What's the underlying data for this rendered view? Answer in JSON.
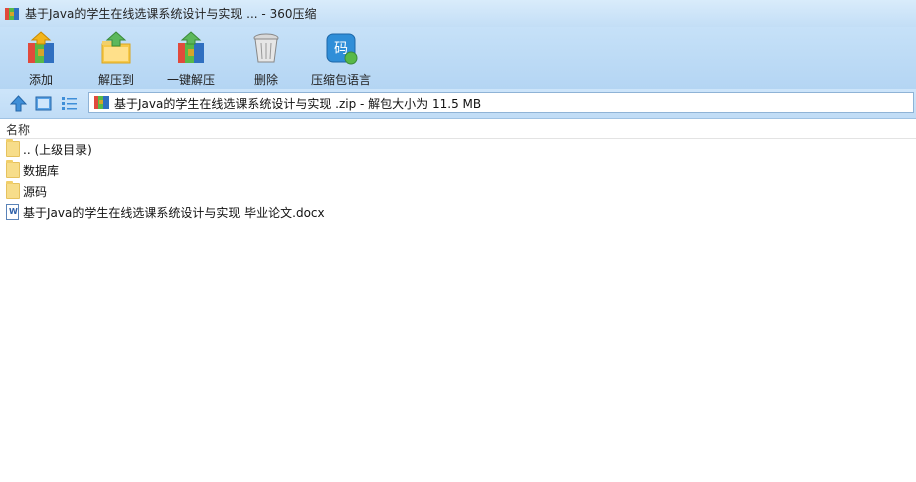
{
  "window": {
    "title": "基于Java的学生在线选课系统设计与实现 ... - 360压缩",
    "icon": "archive-icon"
  },
  "toolbar": {
    "buttons": [
      {
        "label": "添加",
        "icon": "add-archive-icon"
      },
      {
        "label": "解压到",
        "icon": "extract-to-folder-icon"
      },
      {
        "label": "一键解压",
        "icon": "one-click-extract-icon"
      },
      {
        "label": "删除",
        "icon": "trash-bin-icon"
      },
      {
        "label": "压缩包语言",
        "icon": "archive-language-icon",
        "glyph": "码"
      }
    ]
  },
  "navbar": {
    "path": "基于Java的学生在线选课系统设计与实现 .zip - 解包大小为 11.5 MB",
    "icons": [
      "up-arrow-icon",
      "detail-view-icon",
      "list-view-icon"
    ]
  },
  "columns": {
    "name": "名称"
  },
  "files": [
    {
      "name": ".. (上级目录)",
      "type": "folder"
    },
    {
      "name": "数据库",
      "type": "folder"
    },
    {
      "name": "源码",
      "type": "folder"
    },
    {
      "name": "基于Java的学生在线选课系统设计与实现 毕业论文.docx",
      "type": "docx"
    }
  ],
  "colors": {
    "toolbar_bg": "#b4d5f3",
    "titlebar_bg": "#c3def6",
    "folder": "#f7dd8a"
  }
}
